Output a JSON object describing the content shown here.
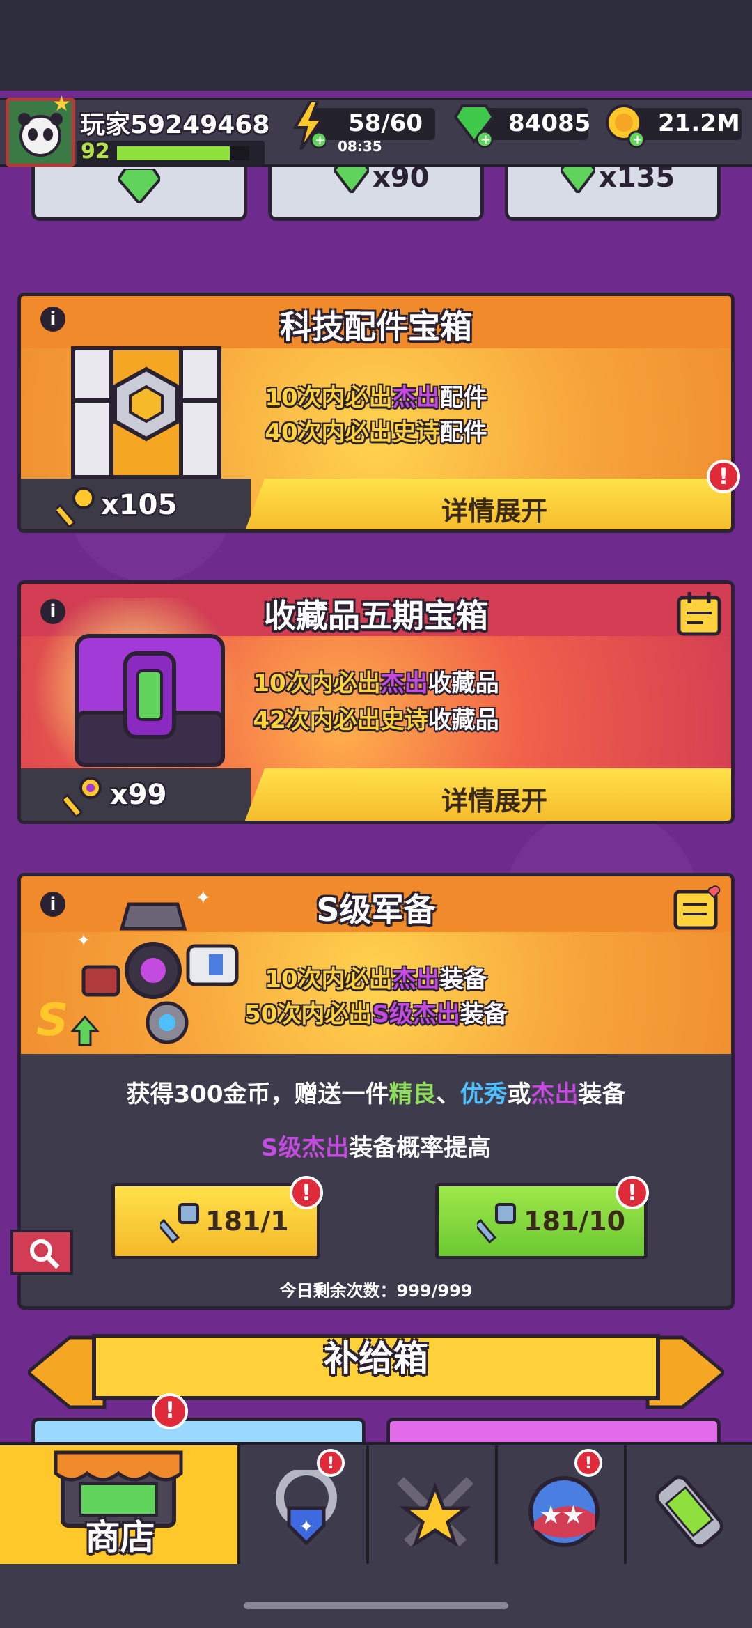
{
  "player": {
    "name": "玩家59249468",
    "level": "92",
    "level_progress": 0.85
  },
  "resources": {
    "energy": "58/60",
    "energy_timer": "08:35",
    "gems": "84085",
    "gold": "21.2M"
  },
  "top_cards": [
    {
      "price": ""
    },
    {
      "price": "x90"
    },
    {
      "price": "x135"
    }
  ],
  "chest_tech": {
    "title": "科技配件宝箱",
    "line1": {
      "pre": "10次内必出",
      "hl": "杰出",
      "post": "配件"
    },
    "line2": {
      "pre": "40次内必出",
      "hl": "史诗",
      "post": "配件"
    },
    "keys": "x105",
    "button": "详情展开",
    "alert": "!"
  },
  "chest_collect": {
    "title": "收藏品五期宝箱",
    "line1": {
      "pre": "10次内必出",
      "hl": "杰出",
      "post": "收藏品"
    },
    "line2": {
      "pre": "42次内必出",
      "hl": "史诗",
      "post": "收藏品"
    },
    "keys": "x99",
    "button": "详情展开"
  },
  "chest_sgrade": {
    "title": "S级军备",
    "line1": {
      "pre": "10次内必出",
      "hl": "杰出",
      "post": "装备"
    },
    "line2": {
      "pre": "50次内必出",
      "hl": "S级杰出",
      "post": "装备"
    },
    "desc_pre": "获得300金币，赠送一件",
    "desc_q1": "精良",
    "desc_sep": "、",
    "desc_q2": "优秀",
    "desc_or": "或",
    "desc_q3": "杰出",
    "desc_post": "装备",
    "boost_hl": "S级杰出",
    "boost_post": "装备概率提高",
    "btn1": "181/1",
    "btn10": "181/10",
    "remaining": "今日剩余次数：999/999",
    "badge": "S"
  },
  "supply": {
    "title": "补给箱"
  },
  "nav": {
    "shop_label": "商店"
  },
  "colors": {
    "background": "#6f2a8e",
    "orange": "#f7a43c",
    "red": "#d23d53",
    "yellow_button": "#f5b92a",
    "green_button": "#7ed43a",
    "epic_purple": "#c54be0",
    "excellent_yellow": "#ffd23c"
  }
}
